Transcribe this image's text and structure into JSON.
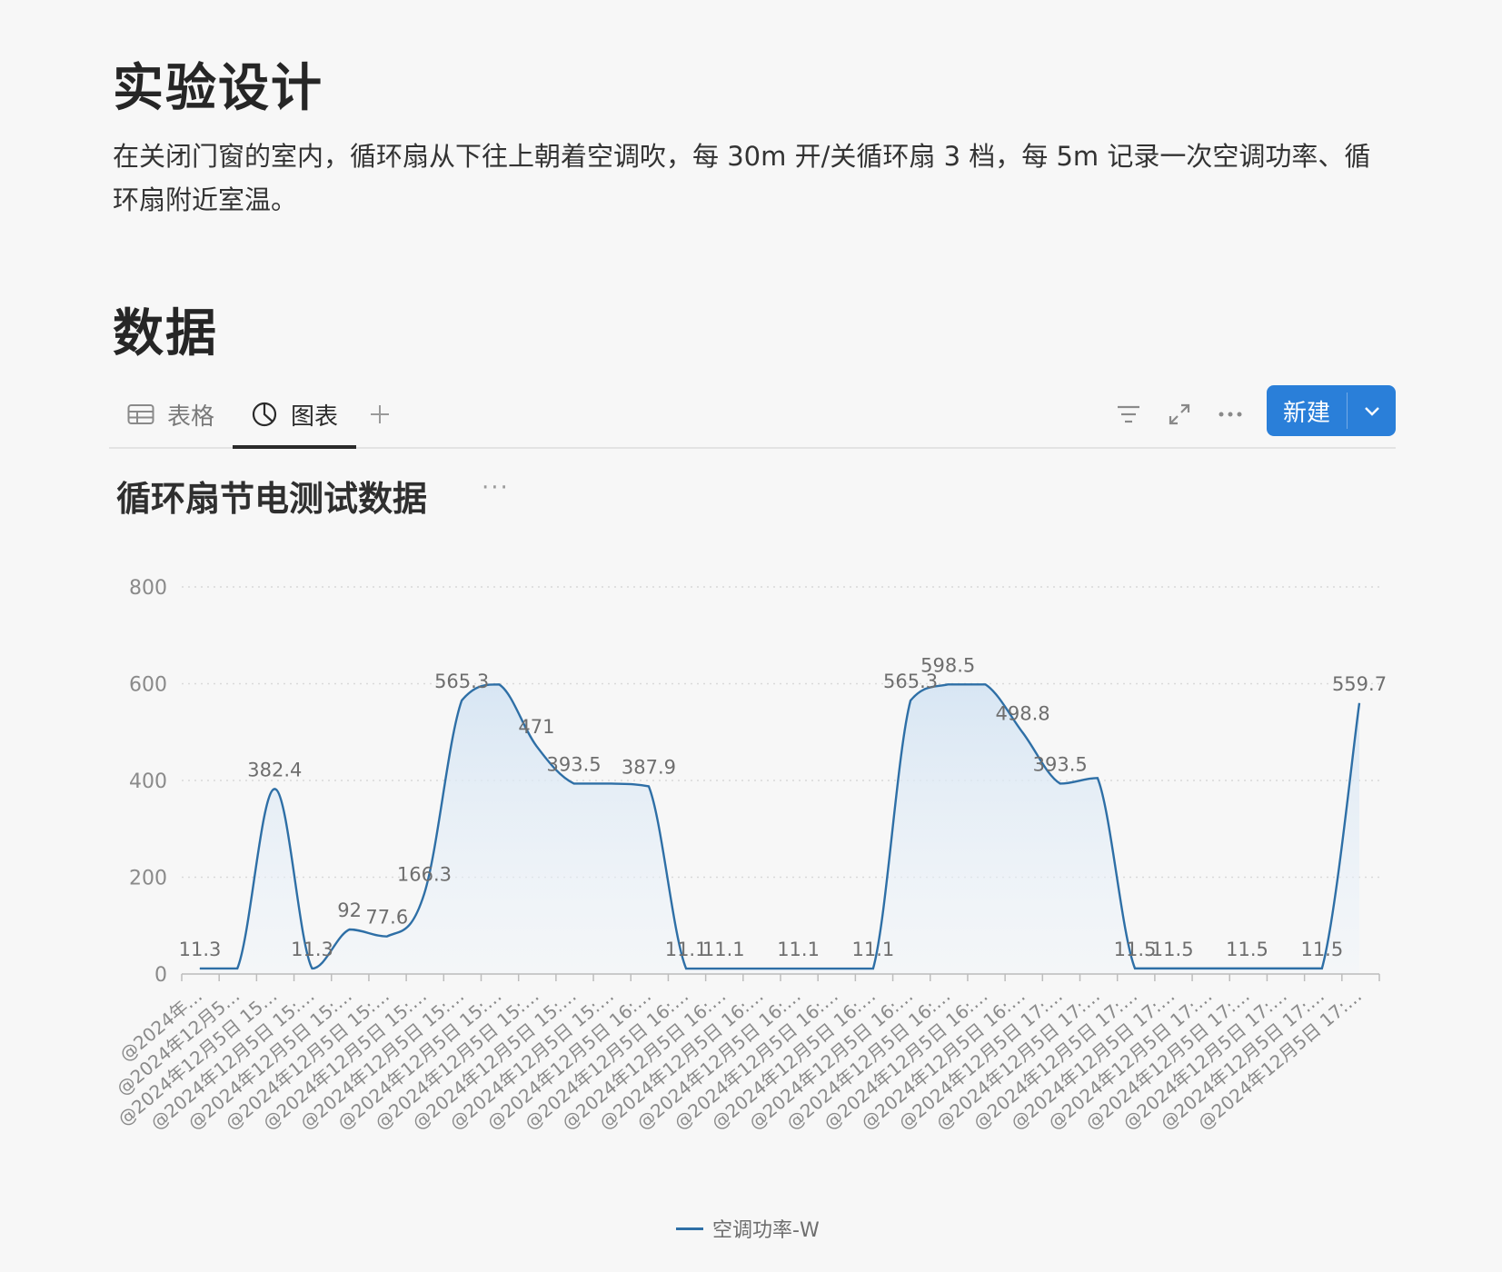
{
  "sections": {
    "design_title": "实验设计",
    "design_text": "在关闭门窗的室内，循环扇从下往上朝着空调吹，每 30m 开/关循环扇 3 档，每 5m 记录一次空调功率、循环扇附近室温。",
    "data_title": "数据"
  },
  "view_tabs": [
    {
      "label": "表格",
      "icon": "table-icon"
    },
    {
      "label": "图表",
      "icon": "pie-chart-icon",
      "active": true
    }
  ],
  "toolbar": {
    "add_icon": "plus-icon",
    "filter_icon": "filter-icon",
    "expand_icon": "expand-icon",
    "more_icon": "ellipsis-icon",
    "new_label": "新建",
    "new_caret_icon": "chevron-down-icon"
  },
  "chart_card": {
    "title": "循环扇节电测试数据",
    "menu": "···"
  },
  "colors": {
    "accent": "#2a7fd9",
    "line": "#2e6fa6",
    "area": "#dbe8f4"
  },
  "chart_data": {
    "type": "area",
    "title": "循环扇节电测试数据",
    "ylim": [
      0,
      800
    ],
    "yticks": [
      0,
      200,
      400,
      600,
      800
    ],
    "grid": true,
    "legend_position": "bottom-center",
    "categories": [
      "@2024年…",
      "@2024年12月5…",
      "@2024年12月5日 15…",
      "@2024年12月5日 15:…",
      "@2024年12月5日 15:…",
      "@2024年12月5日 15:…",
      "@2024年12月5日 15:…",
      "@2024年12月5日 15:…",
      "@2024年12月5日 15:…",
      "@2024年12月5日 15:…",
      "@2024年12月5日 15:…",
      "@2024年12月5日 15:…",
      "@2024年12月5日 16:…",
      "@2024年12月5日 16:…",
      "@2024年12月5日 16:…",
      "@2024年12月5日 16:…",
      "@2024年12月5日 16:…",
      "@2024年12月5日 16:…",
      "@2024年12月5日 16:…",
      "@2024年12月5日 16:…",
      "@2024年12月5日 16:…",
      "@2024年12月5日 16:…",
      "@2024年12月5日 16:…",
      "@2024年12月5日 17:…",
      "@2024年12月5日 17:…",
      "@2024年12月5日 17:…",
      "@2024年12月5日 17:…",
      "@2024年12月5日 17:…",
      "@2024年12月5日 17:…",
      "@2024年12月5日 17:…",
      "@2024年12月5日 17:…",
      "@2024年12月5日 17:…"
    ],
    "series": [
      {
        "name": "空调功率-W",
        "values": [
          11.3,
          11.3,
          382.4,
          11.3,
          92,
          77.6,
          166.3,
          565.3,
          598.5,
          471,
          393.5,
          393.5,
          387.9,
          11.1,
          11.1,
          11.1,
          11.1,
          11.1,
          11.1,
          565.3,
          598.5,
          598.5,
          498.8,
          393.5,
          405,
          11.5,
          11.5,
          11.5,
          11.5,
          11.5,
          11.5,
          559.7
        ],
        "labels": [
          "11.3",
          "",
          "382.4",
          "11.3",
          "92",
          "77.6",
          "166.3",
          "565.3",
          "",
          "471",
          "393.5",
          "",
          "387.9",
          "11.1",
          "11.1",
          "",
          "11.1",
          "",
          "11.1",
          "565.3",
          "598.5",
          "",
          "498.8",
          "393.5",
          "",
          "11.5",
          "11.5",
          "",
          "11.5",
          "",
          "11.5",
          "559.7"
        ]
      }
    ]
  }
}
